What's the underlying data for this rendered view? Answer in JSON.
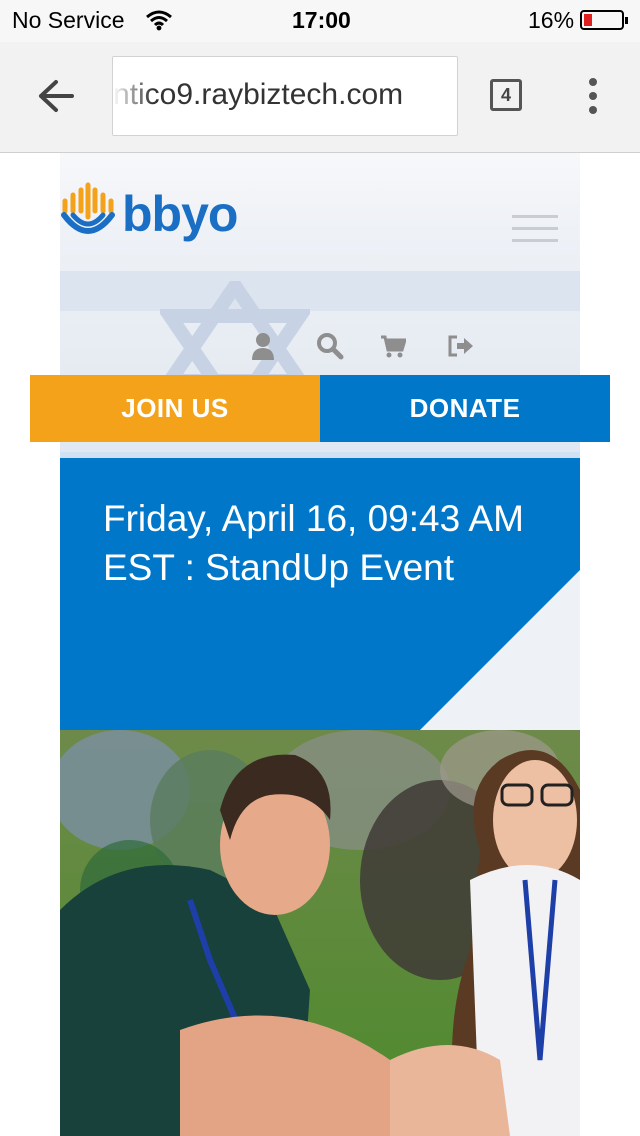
{
  "status_bar": {
    "carrier": "No Service",
    "time": "17:00",
    "battery": "16%"
  },
  "browser": {
    "url": "nticо9.raybiztech.com",
    "tab_count": "4"
  },
  "site": {
    "logo_text": "bbyo",
    "nav_icons": [
      "user-icon",
      "search-icon",
      "cart-icon",
      "logout-icon"
    ],
    "join_label": "JOIN US",
    "donate_label": "DONATE",
    "event_title": "Friday, April 16, 09:43 AM EST : StandUp Event"
  },
  "colors": {
    "orange": "#f5a21b",
    "blue": "#0077c8",
    "logo_blue": "#1a6fc4"
  }
}
